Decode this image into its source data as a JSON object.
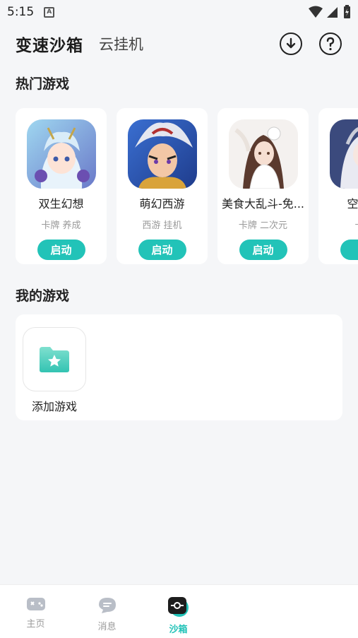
{
  "status_bar": {
    "time": "5:15",
    "notif_glyph": "A"
  },
  "header": {
    "title": "变速沙箱",
    "secondary_tab": "云挂机",
    "download_icon": "download-icon",
    "help_icon": "help-icon"
  },
  "hot_section": {
    "title": "热门游戏"
  },
  "hot_games": [
    {
      "name": "双生幻想",
      "tags": "卡牌 养成",
      "button": "启动"
    },
    {
      "name": "萌幻西游",
      "tags": "西游 挂机",
      "button": "启动"
    },
    {
      "name": "美食大乱斗-免...",
      "tags": "卡牌 二次元",
      "button": "启动"
    },
    {
      "name": "空之要",
      "tags": "卡牌",
      "button": "启"
    }
  ],
  "my_section": {
    "title": "我的游戏",
    "add_label": "添加游戏"
  },
  "colors": {
    "accent": "#22c3b8",
    "background": "#f5f6f8"
  },
  "bottom_nav": [
    {
      "label": "主页",
      "icon": "gamepad-icon"
    },
    {
      "label": "消息",
      "icon": "chat-icon"
    },
    {
      "label": "沙箱",
      "icon": "sandbox-icon",
      "active": true
    }
  ]
}
